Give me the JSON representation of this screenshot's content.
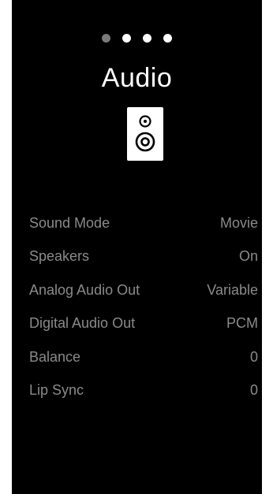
{
  "pager": {
    "dots": [
      {
        "state": "inactive"
      },
      {
        "state": "active"
      },
      {
        "state": "active"
      },
      {
        "state": "active"
      }
    ]
  },
  "header": {
    "title": "Audio",
    "icon": "speaker-icon"
  },
  "settings": [
    {
      "label": "Sound Mode",
      "value": "Movie"
    },
    {
      "label": "Speakers",
      "value": "On"
    },
    {
      "label": "Analog Audio Out",
      "value": "Variable"
    },
    {
      "label": "Digital Audio Out",
      "value": "PCM"
    },
    {
      "label": "Balance",
      "value": "0"
    },
    {
      "label": "Lip Sync",
      "value": "0"
    }
  ],
  "colors": {
    "background": "#000000",
    "text_primary": "#ffffff",
    "text_secondary": "#8a8a8a",
    "dot_inactive": "#7a7a7a"
  }
}
